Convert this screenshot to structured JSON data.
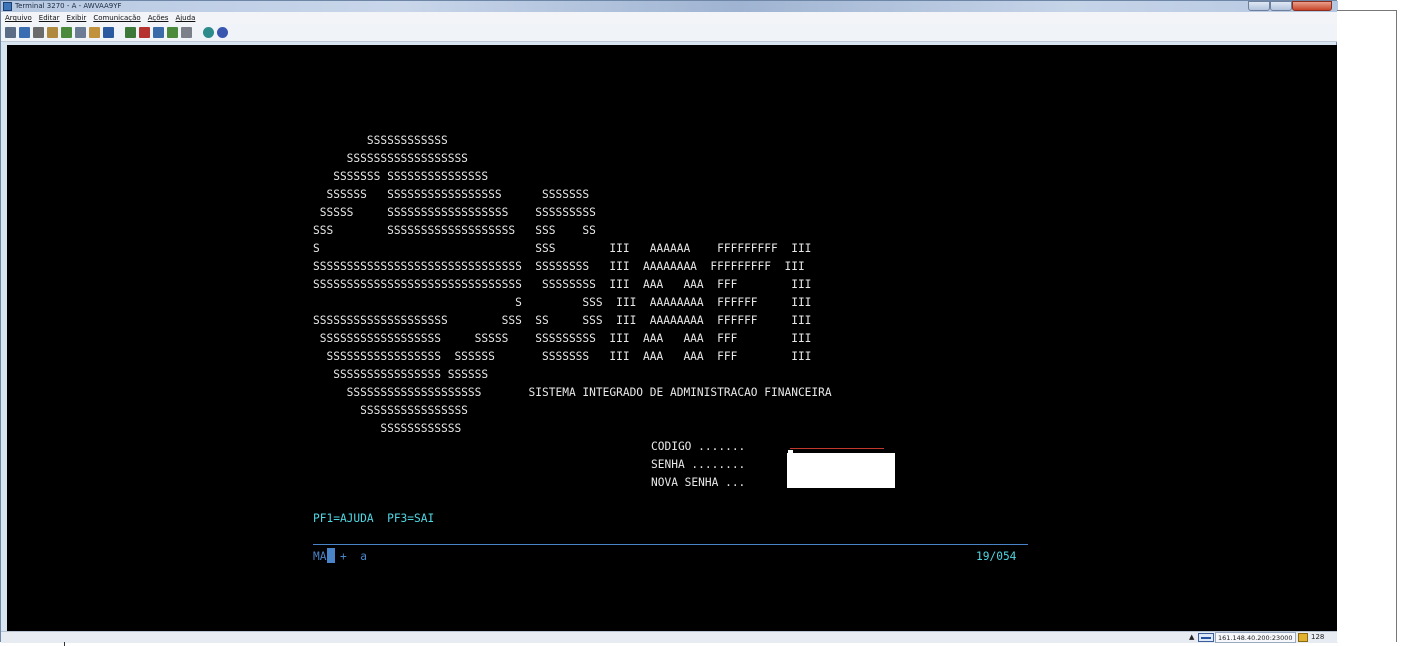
{
  "window": {
    "title": "Terminal 3270 - A - AWVAA9YF",
    "controls": [
      "minimize",
      "maximize",
      "close"
    ]
  },
  "menubar": [
    "Arquivo",
    "Editar",
    "Exibir",
    "Comunicação",
    "Ações",
    "Ajuda"
  ],
  "toolbar": {
    "icons": [
      "copy-icon",
      "paste-icon",
      "send-icon",
      "receive-icon",
      "transfer-icon",
      "print-icon",
      "macro-icon",
      "keyboard-icon",
      "chart-icon",
      "chart-icon-2",
      "chart-icon-3",
      "chart-icon-4",
      "chat-icon",
      "globe-icon",
      "help-icon"
    ]
  },
  "terminal": {
    "art_lines": [
      "        SSSSSSSSSSSS",
      "     SSSSSSSSSSSSSSSSSS",
      "   SSSSSSS SSSSSSSSSSSSSSS",
      "  SSSSSS   SSSSSSSSSSSSSSSSS      SSSSSSS",
      " SSSSS     SSSSSSSSSSSSSSSSSS    SSSSSSSSS",
      "SSS        SSSSSSSSSSSSSSSSSSS   SSS    SS",
      "S                                SSS        III   AAAAAA    FFFFFFFFF  III",
      "SSSSSSSSSSSSSSSSSSSSSSSSSSSSSSS  SSSSSSSS   III  AAAAAAAA  FFFFFFFFF  III",
      "SSSSSSSSSSSSSSSSSSSSSSSSSSSSSSS   SSSSSSSS  III  AAA   AAA  FFF        III",
      "                              S         SSS  III  AAAAAAAA  FFFFFF     III",
      "SSSSSSSSSSSSSSSSSSSS        SSS  SS     SSS  III  AAAAAAAA  FFFFFF     III",
      " SSSSSSSSSSSSSSSSSS     SSSSS    SSSSSSSSS  III  AAA   AAA  FFF        III",
      "  SSSSSSSSSSSSSSSSS  SSSSSS       SSSSSSS   III  AAA   AAA  FFF        III",
      "   SSSSSSSSSSSSSSSS SSSSSS",
      "     SSSSSSSSSSSSSSSSSSSS       SISTEMA INTEGRADO DE ADMINISTRACAO FINANCEIRA",
      "       SSSSSSSSSSSSSSSS",
      "          SSSSSSSSSSSS"
    ],
    "codigo_label": "CODIGO .......",
    "senha_label": "SENHA ........",
    "nova_senha_label": "NOVA SENHA ...",
    "pf_keys": "PF1=AJUDA  PF3=SAI",
    "oia_left": "MA",
    "oia_indicators": "+  a",
    "cursor_position": "19/054"
  },
  "statusbar": {
    "host": "161.148.40.200:23000",
    "session_number": "128"
  },
  "colors": {
    "screen_bg": "#000000",
    "text_white": "#e8e8e8",
    "text_cyan": "#4fd7e4",
    "oia_blue": "#4a84c8"
  }
}
